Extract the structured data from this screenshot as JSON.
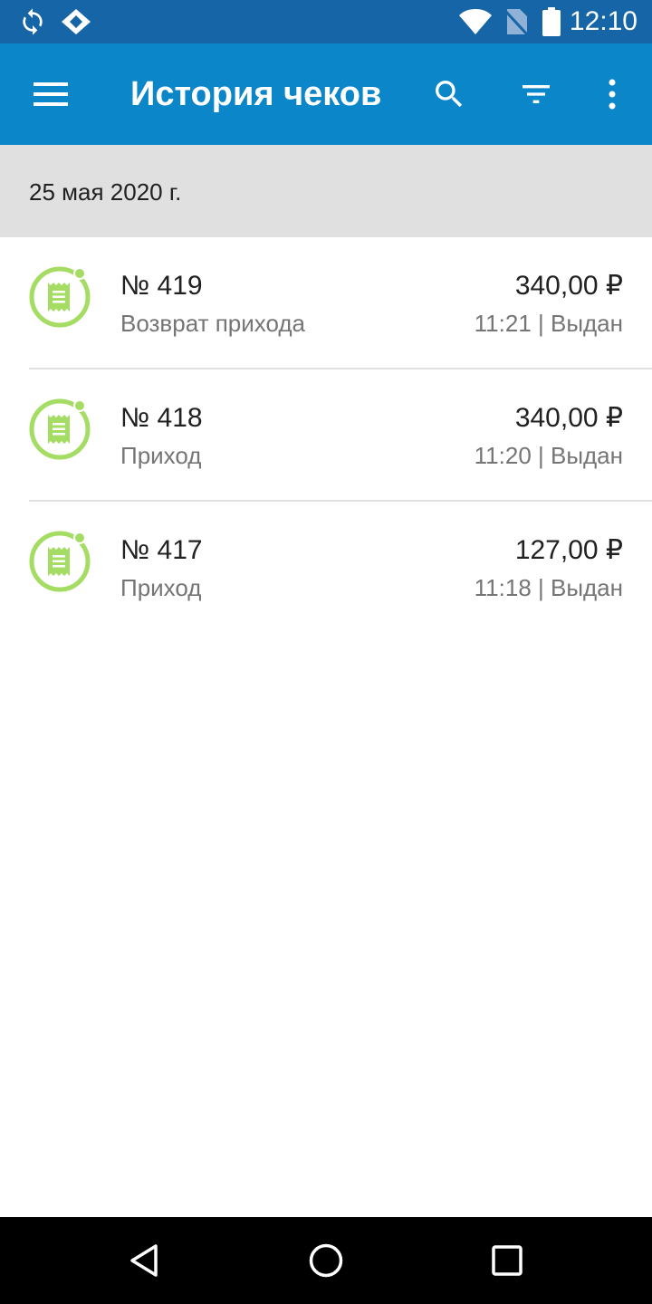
{
  "status_bar": {
    "time": "12:10",
    "icons": [
      "sync-icon",
      "app-notification-icon",
      "wifi-icon",
      "no-sim-icon",
      "battery-icon"
    ]
  },
  "app_bar": {
    "title": "История чеков",
    "icons": [
      "menu-icon",
      "search-icon",
      "filter-icon",
      "more-vert-icon"
    ]
  },
  "date_header": "25 мая 2020 г.",
  "colors": {
    "status_bar": "#1565a7",
    "app_bar": "#0b86c8",
    "receipt_icon": "#a5dc63",
    "date_header_bg": "#e0e0e0"
  },
  "receipts": [
    {
      "number": "№ 419",
      "type": "Возврат прихода",
      "amount": "340,00 ₽",
      "meta": "11:21 | Выдан"
    },
    {
      "number": "№ 418",
      "type": "Приход",
      "amount": "340,00 ₽",
      "meta": "11:20 | Выдан"
    },
    {
      "number": "№ 417",
      "type": "Приход",
      "amount": "127,00 ₽",
      "meta": "11:18 | Выдан"
    }
  ],
  "nav_bar": {
    "icons": [
      "back-icon",
      "home-icon",
      "recents-icon"
    ]
  }
}
